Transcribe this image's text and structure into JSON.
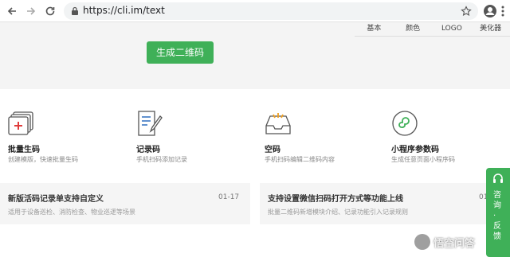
{
  "browser": {
    "url": "https://cli.im/text",
    "icons": [
      "back-icon",
      "forward-icon",
      "reload-icon",
      "lock-icon",
      "star-icon",
      "profile-icon",
      "menu-icon"
    ]
  },
  "style_tabs": [
    "基本",
    "颜色",
    "LOGO",
    "美化器"
  ],
  "generate_button": "生成二维码",
  "features": [
    {
      "title": "批量生码",
      "desc": "创建模版，快速批量生码",
      "icon": "batch-code-icon"
    },
    {
      "title": "记录码",
      "desc": "手机扫码添加记录",
      "icon": "record-code-icon"
    },
    {
      "title": "空码",
      "desc": "手机扫码编辑二维码内容",
      "icon": "empty-code-icon"
    },
    {
      "title": "小程序参数码",
      "desc": "生成任意页面小程序码",
      "icon": "mini-program-icon"
    }
  ],
  "news": [
    {
      "title": "新版活码记录单支持自定义",
      "date": "01-17",
      "desc": "适用于设备巡检、消防检查、物业巡逻等场景"
    },
    {
      "title": "支持设置微信扫码打开方式等功能上线",
      "date": "01",
      "desc": "批量二维码新增模块介绍、记录功能引入记录规则"
    }
  ],
  "side_tab": {
    "label": "咨询 · 反馈",
    "icon": "headset-icon"
  },
  "watermark": {
    "text": "悟空问答"
  },
  "colors": {
    "accent": "#3fb058",
    "feature_icon_red": "#e03c3c",
    "feature_icon_blue": "#2f6fbf",
    "feature_icon_orange": "#f0a020"
  }
}
